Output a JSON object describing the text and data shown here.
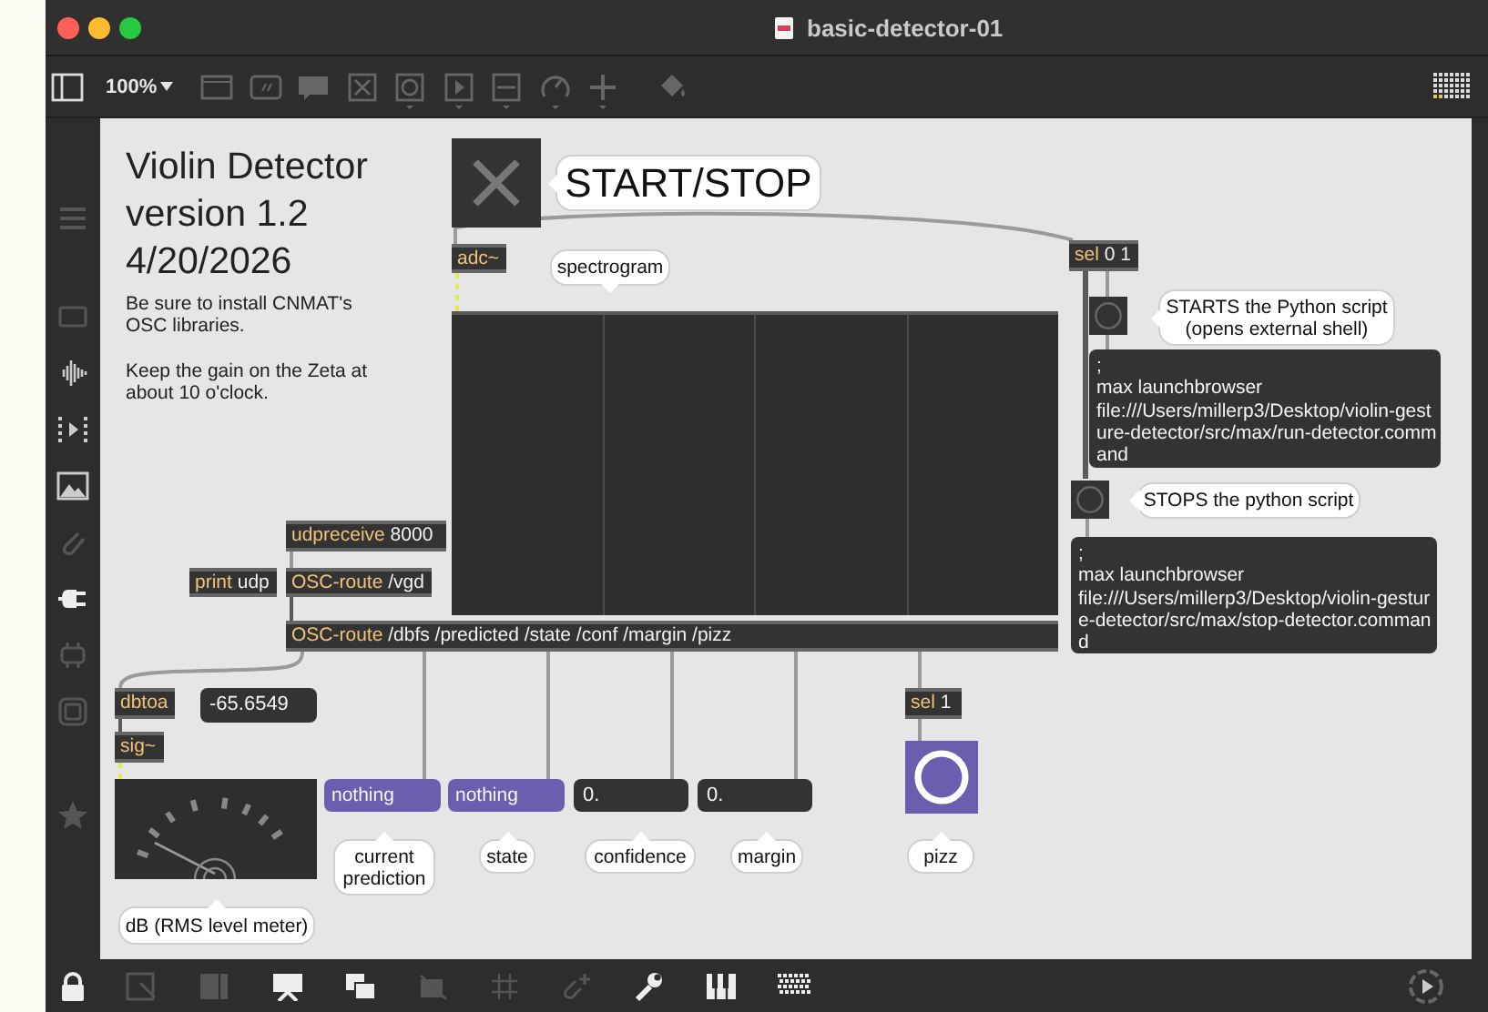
{
  "window": {
    "title": "basic-detector-01",
    "zoom": "100%"
  },
  "patcher": {
    "objects": [
      {
        "kind": "heading",
        "text": "Violin Detector\nversion 1.2\n4/20/2026"
      },
      {
        "kind": "comment",
        "text": "Be sure to install CNMAT's\nOSC libraries."
      },
      {
        "kind": "comment",
        "text": "Keep the gain on the Zeta at\nabout 10 o'clock."
      },
      {
        "kind": "toggle",
        "on": false
      },
      {
        "kind": "bubble",
        "text": "START/STOP"
      },
      {
        "kind": "object",
        "name": "adc~"
      },
      {
        "kind": "bubble",
        "text": "spectrogram"
      },
      {
        "kind": "spectroscope"
      },
      {
        "kind": "object",
        "name": "sel",
        "args": "0 1"
      },
      {
        "kind": "button",
        "color": "#333333"
      },
      {
        "kind": "bubble",
        "text": "STARTS the Python script\n(opens external shell)"
      },
      {
        "kind": "message",
        "color": "#333333",
        "text": ";\nmax launchbrowser\nfile:///Users/millerp3/Desktop/violin-gest\nure-detector/src/max/run-detector.comm\nand"
      },
      {
        "kind": "button",
        "color": "#333333"
      },
      {
        "kind": "bubble",
        "text": "STOPS the python script"
      },
      {
        "kind": "message",
        "color": "#333333",
        "text": ";\nmax launchbrowser\nfile:///Users/millerp3/Desktop/violin-gestur\ne-detector/src/max/stop-detector.comman\nd"
      },
      {
        "kind": "object",
        "name": "udpreceive",
        "args": "8000"
      },
      {
        "kind": "object",
        "name": "print",
        "args": "udp"
      },
      {
        "kind": "object",
        "name": "OSC-route",
        "args": "/vgd"
      },
      {
        "kind": "object",
        "name": "OSC-route",
        "args": "/dbfs /predicted /state /conf /margin /pizz"
      },
      {
        "kind": "object",
        "name": "dbtoa"
      },
      {
        "kind": "number",
        "text": "-65.6549"
      },
      {
        "kind": "object",
        "name": "sig~"
      },
      {
        "kind": "meter"
      },
      {
        "kind": "bubble",
        "text": "dB (RMS level meter)"
      },
      {
        "kind": "message",
        "color": "#6a5fae",
        "text": "nothing"
      },
      {
        "kind": "message",
        "color": "#6a5fae",
        "text": "nothing"
      },
      {
        "kind": "number",
        "text": "0."
      },
      {
        "kind": "number",
        "text": "0."
      },
      {
        "kind": "bubble",
        "text": "current\nprediction"
      },
      {
        "kind": "bubble",
        "text": "state"
      },
      {
        "kind": "bubble",
        "text": "confidence"
      },
      {
        "kind": "bubble",
        "text": "margin"
      },
      {
        "kind": "object",
        "name": "sel",
        "args": "1"
      },
      {
        "kind": "button",
        "color": "#6a5fae"
      },
      {
        "kind": "bubble",
        "text": "pizz"
      }
    ]
  }
}
